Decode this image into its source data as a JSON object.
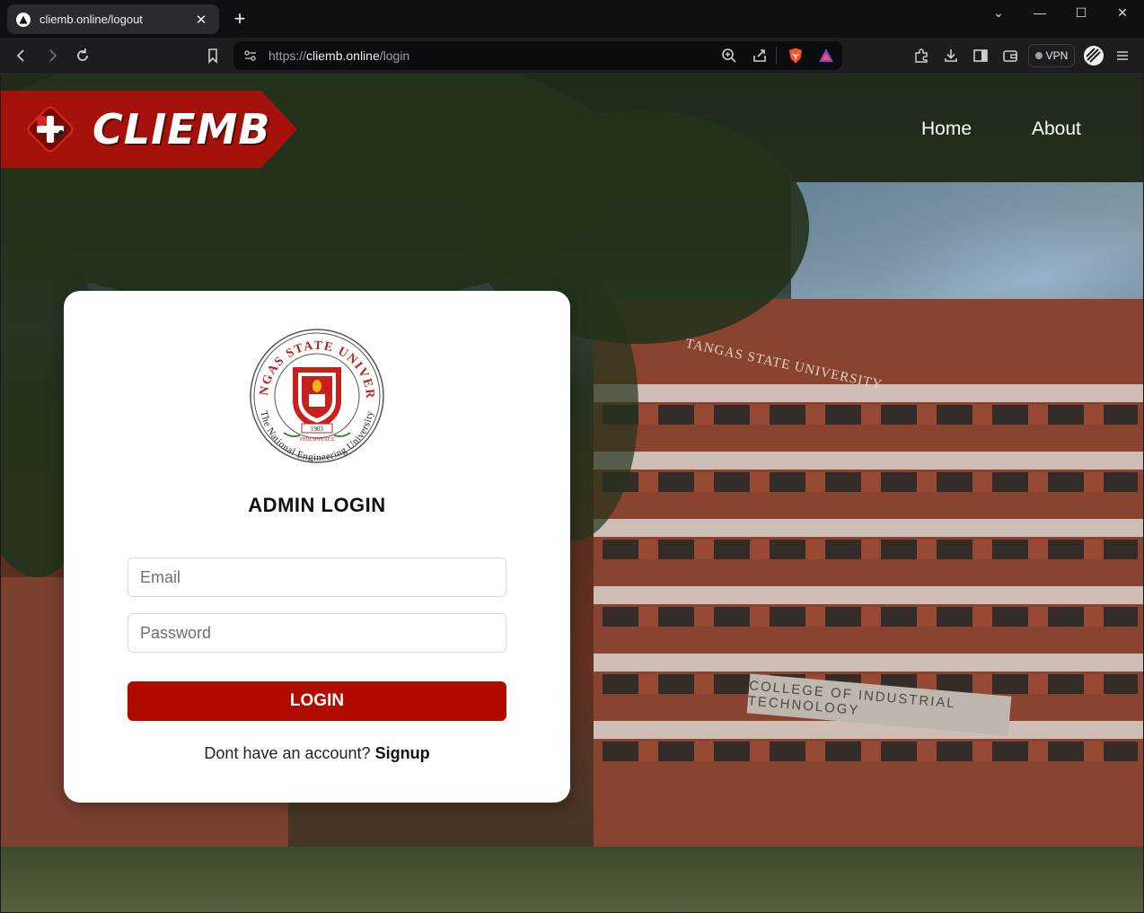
{
  "browser": {
    "tab_title": "cliemb.online/logout",
    "tab_close": "✕",
    "new_tab": "+",
    "url_scheme": "https://",
    "url_host": "cliemb.online",
    "url_path": "/login",
    "vpn_label": "VPN",
    "window_controls": {
      "tab_search": "⌄",
      "minimize": "—",
      "maximize": "☐",
      "close": "✕"
    }
  },
  "header": {
    "brand_name": "CLIEMB",
    "nav": [
      "Home",
      "About"
    ]
  },
  "background_signs": {
    "university": "TANGAS STATE UNIVERSITY",
    "college": "COLLEGE OF INDUSTRIAL TECHNOLOGY"
  },
  "seal": {
    "top_text": "BATANGAS STATE UNIVERSITY",
    "bottom_text": "The National Engineering University",
    "country": "PHILIPPINES",
    "year": "1903"
  },
  "login": {
    "title": "ADMIN LOGIN",
    "email_placeholder": "Email",
    "password_placeholder": "Password",
    "button": "LOGIN",
    "signup_prompt": "Dont have an account?",
    "signup_link": "Signup"
  },
  "colors": {
    "brand_red": "#a5120b",
    "button_red": "#b10b00"
  }
}
